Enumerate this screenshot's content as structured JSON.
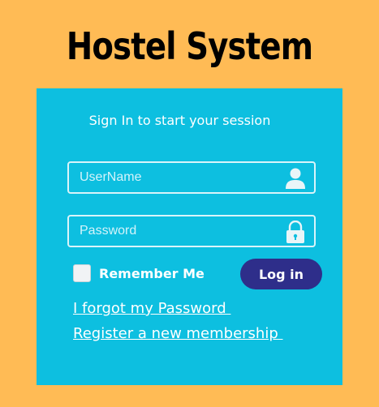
{
  "app": {
    "title": "Hostel System"
  },
  "login": {
    "subtitle": "Sign In to start your session",
    "username": {
      "placeholder": "UserName",
      "value": "",
      "icon": "user-icon"
    },
    "password": {
      "placeholder": "Password",
      "value": "",
      "icon": "lock-icon"
    },
    "remember_me": {
      "label": "Remember Me",
      "checked": false
    },
    "login_button_label": "Log in",
    "forgot_password_link": "I forgot my Password ",
    "register_link": "Register a new membership "
  },
  "colors": {
    "page_background": "#FFBB55",
    "panel_background": "#0DBFE0",
    "button_background": "#2E2E8A",
    "text": "#FFFFFF"
  }
}
